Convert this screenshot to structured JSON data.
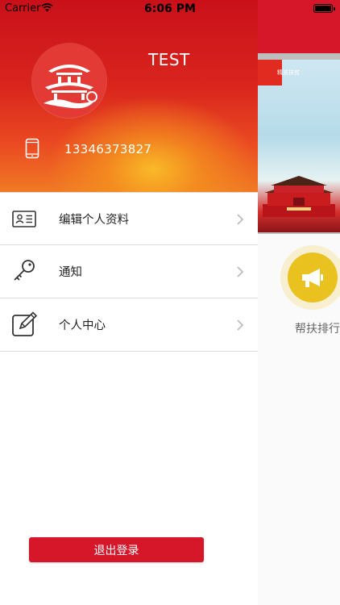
{
  "status_bar": {
    "carrier": "Carrier",
    "time": "6:06 PM"
  },
  "profile": {
    "username": "TEST",
    "phone": "13346373827"
  },
  "menu": [
    {
      "label": "编辑个人资料",
      "icon": "id-card-icon"
    },
    {
      "label": "通知",
      "icon": "key-icon"
    },
    {
      "label": "个人中心",
      "icon": "edit-icon"
    }
  ],
  "logout_label": "退出登录",
  "background_screen": {
    "rank_label": "帮扶排行",
    "banner_text": "精准扶贫"
  },
  "colors": {
    "brand_red": "#d6172a",
    "header_glow": "#f5b22a",
    "megaphone_yellow": "#eac21f"
  }
}
